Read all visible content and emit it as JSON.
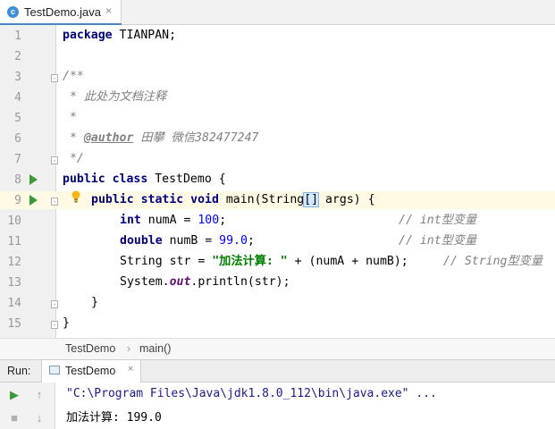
{
  "editor_tab": {
    "icon": "java-class-icon",
    "label": "TestDemo.java",
    "close": "×"
  },
  "line_numbers": [
    "1",
    "2",
    "3",
    "4",
    "5",
    "6",
    "7",
    "8",
    "9",
    "10",
    "11",
    "12",
    "13",
    "14",
    "15"
  ],
  "code": {
    "l1_kw": "package",
    "l1_rest": " TIANPAN;",
    "l3": "/**",
    "l4": " * 此处为文档注释",
    "l5": " *",
    "l6_pre": " * ",
    "l6_tag": "@author",
    "l6_post": " 田攀 微信382477247",
    "l7": " */",
    "l8_kw1": "public",
    "l8_kw2": "class",
    "l8_name": " TestDemo {",
    "l9_kw": "public static void",
    "l9_a": " main(String",
    "l9_br": "[]",
    "l9_b": " args) {",
    "l10_kw": "int",
    "l10_a": " numA = ",
    "l10_num": "100",
    "l10_b": ";",
    "l10_cm": "// int型变量",
    "l11_kw": "double",
    "l11_a": " numB = ",
    "l11_num": "99.0",
    "l11_b": ";",
    "l11_cm": "// int型变量",
    "l12_a": "String str = ",
    "l12_str": "\"加法计算: \"",
    "l12_b": " + (numA + numB);",
    "l12_cm": "// String型变量",
    "l13_a": "System.",
    "l13_out": "out",
    "l13_b": ".println(str);",
    "l14": "}",
    "l15": "}"
  },
  "breadcrumb": {
    "class": "TestDemo",
    "sep": "›",
    "method": "main()"
  },
  "run_panel": {
    "label": "Run:",
    "tab_label": "TestDemo",
    "close": "×"
  },
  "console": {
    "command": "\"C:\\Program Files\\Java\\jdk1.8.0_112\\bin\\java.exe\" ...",
    "output": "加法计算: 199.0"
  },
  "colors": {
    "keyword": "#000080",
    "string": "#008000",
    "number": "#0000ff",
    "comment": "#808080",
    "run_green": "#3a9a3a"
  }
}
